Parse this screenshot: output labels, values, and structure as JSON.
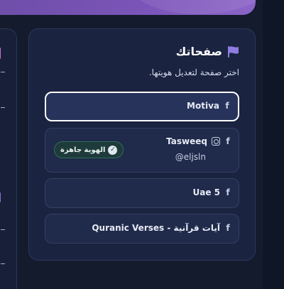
{
  "card": {
    "title": "صفحاتك",
    "subtitle": "اختر صفحة لتعديل هويتها."
  },
  "pages": [
    {
      "name": "Motiva",
      "handle": null,
      "platforms": [
        "facebook"
      ],
      "selected": true,
      "badge": null
    },
    {
      "name": "Tasweeq",
      "handle": "@eljsln",
      "platforms": [
        "facebook",
        "instagram"
      ],
      "selected": false,
      "badge": "الهوية جاهزة"
    },
    {
      "name": "Uae 5",
      "handle": null,
      "platforms": [
        "facebook"
      ],
      "selected": false,
      "badge": null
    },
    {
      "name": "آيات قرآنية - Quranic Verses",
      "handle": null,
      "platforms": [
        "facebook"
      ],
      "selected": false,
      "badge": null
    }
  ],
  "icons": {
    "flag": "flag-icon",
    "facebook": "facebook-icon",
    "instagram": "instagram-icon",
    "check": "check-circle-icon"
  },
  "colors": {
    "background": "#131b2d",
    "card": "#1a2340",
    "accent_purple": "#7b55b9",
    "badge_green": "#2f6f57"
  }
}
